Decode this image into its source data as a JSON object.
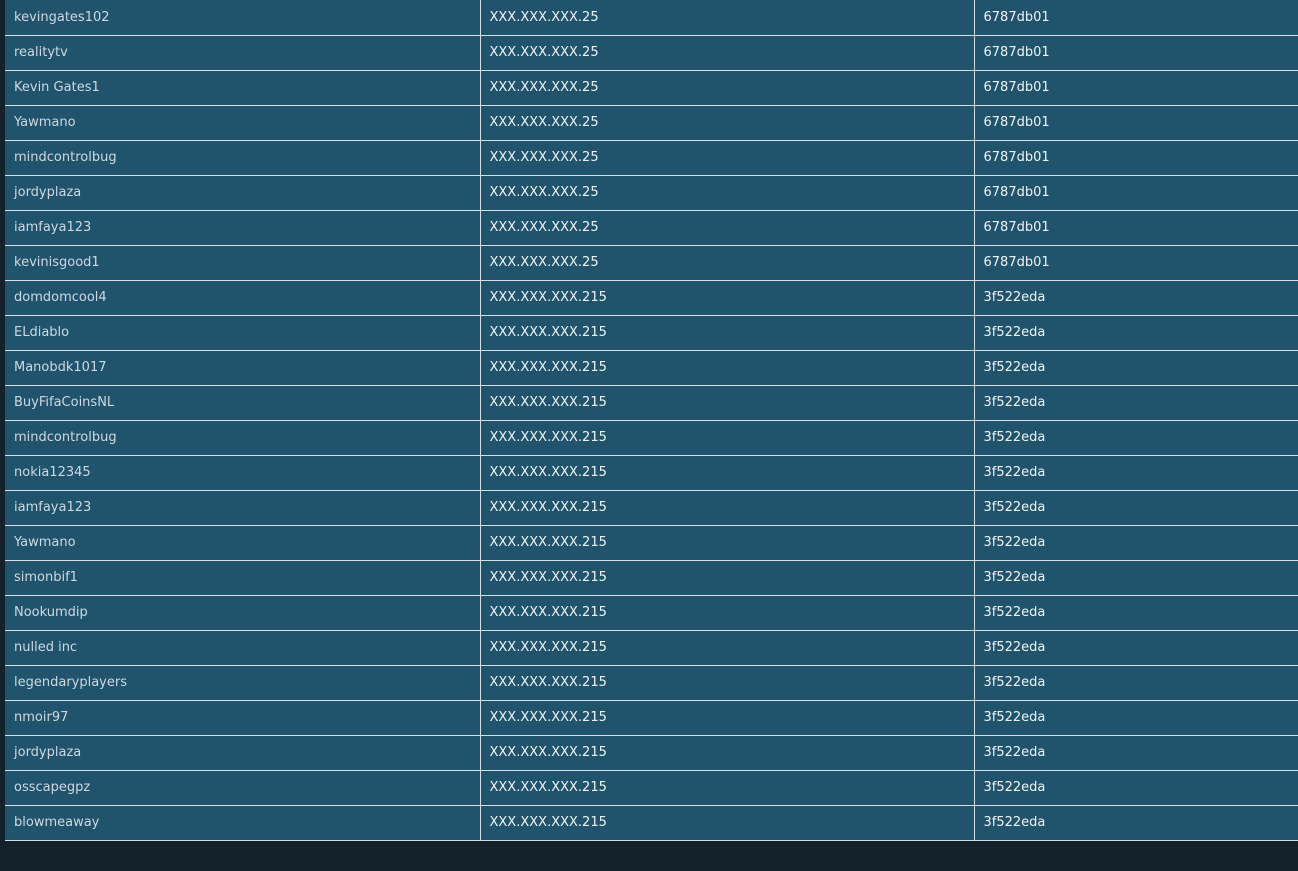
{
  "rows": [
    {
      "username": "kevingates102",
      "ip": "XXX.XXX.XXX.25",
      "hash": "6787db01"
    },
    {
      "username": "realitytv",
      "ip": "XXX.XXX.XXX.25",
      "hash": "6787db01"
    },
    {
      "username": "Kevin Gates1",
      "ip": "XXX.XXX.XXX.25",
      "hash": "6787db01"
    },
    {
      "username": "Yawmano",
      "ip": "XXX.XXX.XXX.25",
      "hash": "6787db01"
    },
    {
      "username": "mindcontrolbug",
      "ip": "XXX.XXX.XXX.25",
      "hash": "6787db01"
    },
    {
      "username": "jordyplaza",
      "ip": "XXX.XXX.XXX.25",
      "hash": "6787db01"
    },
    {
      "username": "iamfaya123",
      "ip": "XXX.XXX.XXX.25",
      "hash": "6787db01"
    },
    {
      "username": "kevinisgood1",
      "ip": "XXX.XXX.XXX.25",
      "hash": "6787db01"
    },
    {
      "username": "domdomcool4",
      "ip": "XXX.XXX.XXX.215",
      "hash": "3f522eda"
    },
    {
      "username": "ELdiablo",
      "ip": "XXX.XXX.XXX.215",
      "hash": "3f522eda"
    },
    {
      "username": "Manobdk1017",
      "ip": "XXX.XXX.XXX.215",
      "hash": "3f522eda"
    },
    {
      "username": "BuyFifaCoinsNL",
      "ip": "XXX.XXX.XXX.215",
      "hash": "3f522eda"
    },
    {
      "username": "mindcontrolbug",
      "ip": "XXX.XXX.XXX.215",
      "hash": "3f522eda"
    },
    {
      "username": "nokia12345",
      "ip": "XXX.XXX.XXX.215",
      "hash": "3f522eda"
    },
    {
      "username": "iamfaya123",
      "ip": "XXX.XXX.XXX.215",
      "hash": "3f522eda"
    },
    {
      "username": "Yawmano",
      "ip": "XXX.XXX.XXX.215",
      "hash": "3f522eda"
    },
    {
      "username": "simonbif1",
      "ip": "XXX.XXX.XXX.215",
      "hash": "3f522eda"
    },
    {
      "username": "Nookumdip",
      "ip": "XXX.XXX.XXX.215",
      "hash": "3f522eda"
    },
    {
      "username": "nulled inc",
      "ip": "XXX.XXX.XXX.215",
      "hash": "3f522eda"
    },
    {
      "username": "legendaryplayers",
      "ip": "XXX.XXX.XXX.215",
      "hash": "3f522eda"
    },
    {
      "username": "nmoir97",
      "ip": "XXX.XXX.XXX.215",
      "hash": "3f522eda"
    },
    {
      "username": "jordyplaza",
      "ip": "XXX.XXX.XXX.215",
      "hash": "3f522eda"
    },
    {
      "username": "osscapegpz",
      "ip": "XXX.XXX.XXX.215",
      "hash": "3f522eda"
    },
    {
      "username": "blowmeaway",
      "ip": "XXX.XXX.XXX.215",
      "hash": "3f522eda"
    }
  ]
}
